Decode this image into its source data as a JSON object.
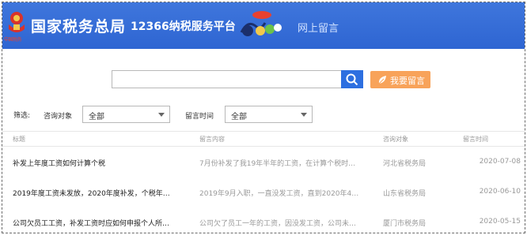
{
  "header": {
    "emblem_text": "中国税务",
    "site_title": "国家税务总局",
    "platform_title": "12366纳税服务平台",
    "logo_badge": "",
    "section_title": "网上留言"
  },
  "search": {
    "placeholder": "",
    "button_icon": "search-icon",
    "leave_message_label": "我要留言",
    "leave_message_icon": "leaf-icon"
  },
  "filter": {
    "label": "筛选:",
    "target_label": "咨询对象",
    "target_value": "全部",
    "time_label": "留言时间",
    "time_value": "全部"
  },
  "table": {
    "headers": [
      "标题",
      "留言内容",
      "咨询对象",
      "留言时间"
    ],
    "rows": [
      {
        "title": "补发上年度工资如何计算个税",
        "content": "7月份补发了我19年半年的工资，在计算个税时…",
        "org": "河北省税务局",
        "date": "2020-07-08"
      },
      {
        "title": "2019年度工资未发放，2020年度补发，个税年…",
        "content": "2019年9月入职，一直没发工资，直到2020年4…",
        "org": "山东省税务局",
        "date": "2020-06-10"
      },
      {
        "title": "公司欠员工工资，补发工资时应如何申报个人所…",
        "content": "公司欠了员工一年的工资，因没发工资，公司未…",
        "org": "厦门市税务局",
        "date": "2020-05-15"
      }
    ]
  },
  "colors": {
    "header_bg": "#3270d8",
    "search_button": "#2d6fe0",
    "message_button": "#f8a35a"
  }
}
